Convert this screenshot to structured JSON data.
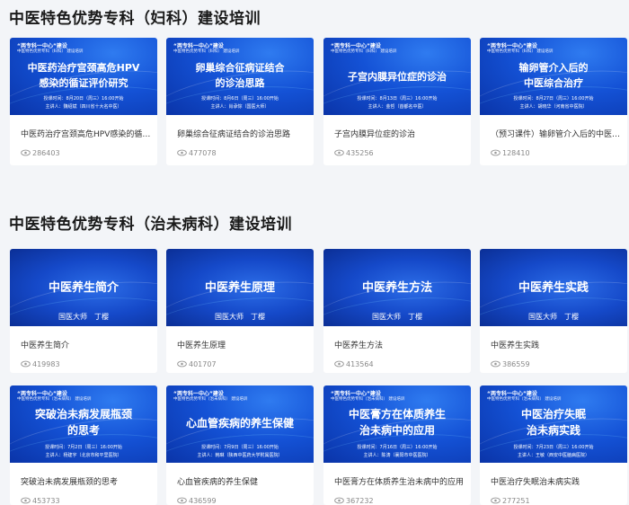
{
  "sections": [
    {
      "title": "中医特色优势专科（妇科）建设培训",
      "cards": [
        {
          "banner_top": "“两专科一中心”建设",
          "banner_sub": "中医特色优势专科（妇科） 建设培训",
          "banner_lines": [
            "中医药治疗宫颈高危HPV",
            "感染的循证评价研究"
          ],
          "meta_lines": [
            "授课时间：8月20日（周三）16:00开始",
            "主讲人：魏绍斌（四川省十大名中医）"
          ],
          "title": "中医药治疗宫颈高危HPV感染的循证评价研究",
          "views": "286403"
        },
        {
          "banner_top": "“两专科一中心”建设",
          "banner_sub": "中医特色优势专科（妇科） 建设培训",
          "banner_lines": [
            "卵巢综合征病证结合",
            "的诊治思路"
          ],
          "meta_lines": [
            "授课时间：8月6日（周三）16:00开始",
            "主讲人：肖承悰（国医大师）"
          ],
          "title": "卵巢综合征病证结合的诊治思路",
          "views": "477078"
        },
        {
          "banner_top": "“两专科一中心”建设",
          "banner_sub": "中医特色优势专科（妇科） 建设培训",
          "banner_lines": [
            "子宫内膜异位症的诊治"
          ],
          "meta_lines": [
            "授课时间：8月13日（周三）16:00开始",
            "主讲人：金哲（首都名中医）"
          ],
          "title": "子宫内膜异位症的诊治",
          "views": "435256"
        },
        {
          "banner_top": "“两专科一中心”建设",
          "banner_sub": "中医特色优势专科（妇科） 建设培训",
          "banner_lines": [
            "输卵管介入后的",
            "中医综合治疗"
          ],
          "meta_lines": [
            "授课时间：8月27日（周三）16:00开始",
            "主讲人：胡晓华（河南省中医院）"
          ],
          "title": "（预习课件）输卵管介入后的中医综合治疗",
          "views": "128410"
        }
      ]
    },
    {
      "title": "中医特色优势专科（治未病科）建设培训",
      "cards": [
        {
          "plain_title": "中医养生简介",
          "teacher": "国医大师　丁樱",
          "title": "中医养生简介",
          "views": "419983"
        },
        {
          "plain_title": "中医养生原理",
          "teacher": "国医大师　丁樱",
          "title": "中医养生原理",
          "views": "401707"
        },
        {
          "plain_title": "中医养生方法",
          "teacher": "国医大师　丁樱",
          "title": "中医养生方法",
          "views": "413564"
        },
        {
          "plain_title": "中医养生实践",
          "teacher": "国医大师　丁樱",
          "title": "中医养生实践",
          "views": "386559"
        },
        {
          "banner_top": "“两专科一中心”建设",
          "banner_sub": "中医特色优势专科（治未病科） 建设培训",
          "banner_lines": [
            "突破治未病发展瓶颈",
            "的思考"
          ],
          "meta_lines": [
            "授课时间：7月2日（周三）16:00开始",
            "主讲人：杨建宇（北京市和平里医院）"
          ],
          "title": "突破治未病发展瓶颈的思考",
          "views": "453733"
        },
        {
          "banner_top": "“两专科一中心”建设",
          "banner_sub": "中医特色优势专科（治未病科） 建设培训",
          "banner_lines": [
            "心血管疾病的养生保健"
          ],
          "meta_lines": [
            "授课时间：7月9日（周三）16:00开始",
            "主讲人：韩琳（陕西中医药大学附属医院）"
          ],
          "title": "心血管疾病的养生保健",
          "views": "436599"
        },
        {
          "banner_top": "“两专科一中心”建设",
          "banner_sub": "中医特色优势专科（治未病科） 建设培训",
          "banner_lines": [
            "中医膏方在体质养生",
            "治未病中的应用"
          ],
          "meta_lines": [
            "授课时间：7月16日（周三）16:00开始",
            "主讲人：陈涛（襄阳市中医医院）"
          ],
          "title": "中医膏方在体质养生治未病中的应用",
          "views": "367232"
        },
        {
          "banner_top": "“两专科一中心”建设",
          "banner_sub": "中医特色优势专科（治未病科） 建设培训",
          "banner_lines": [
            "中医治疗失眠",
            "治未病实践"
          ],
          "meta_lines": [
            "授课时间：7月23日（周三）16:00开始",
            "主讲人：王敏（西安中医脑病医院）"
          ],
          "title": "中医治疗失眠治未病实践",
          "views": "277251"
        }
      ]
    }
  ],
  "icons": {
    "views": "eye-icon"
  },
  "colors": {
    "banner_blue": "#1452d6",
    "background": "#f3f5f8",
    "title_text": "#1a1a1a",
    "muted_text": "#888888"
  }
}
